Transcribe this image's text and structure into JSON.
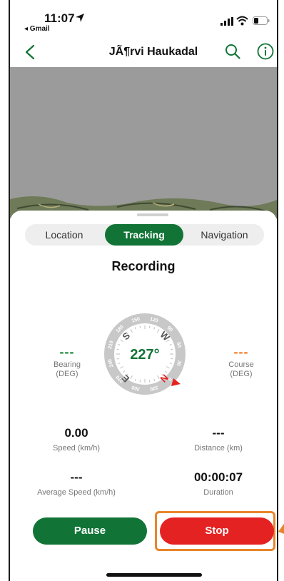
{
  "status_bar": {
    "time": "11:07",
    "back_app": "◂ Gmail"
  },
  "nav": {
    "title": "JÃ¶rvi Haukadal"
  },
  "tabs": [
    {
      "label": "Location",
      "selected": false
    },
    {
      "label": "Tracking",
      "selected": true
    },
    {
      "label": "Navigation",
      "selected": false
    }
  ],
  "tracking": {
    "status": "Recording",
    "compass": {
      "heading": "227°",
      "ring_labels": [
        "0",
        "30",
        "60",
        "90",
        "120",
        "150",
        "180",
        "210",
        "240",
        "270",
        "300",
        "330"
      ],
      "cardinals": {
        "north": "N",
        "east": "E",
        "south": "S",
        "west": "W"
      }
    },
    "bearing": {
      "value": "---",
      "label_line1": "Bearing",
      "label_line2": "(DEG)"
    },
    "course": {
      "value": "---",
      "label_line1": "Course",
      "label_line2": "(DEG)"
    },
    "stats": {
      "speed": {
        "value": "0.00",
        "label": "Speed (km/h)"
      },
      "distance": {
        "value": "---",
        "label": "Distance (km)"
      },
      "average_speed": {
        "value": "---",
        "label": "Average Speed (km/h)"
      },
      "duration": {
        "value": "00:00:07",
        "label": "Duration"
      }
    }
  },
  "actions": {
    "pause_label": "Pause",
    "stop_label": "Stop"
  },
  "colors": {
    "primary_green": "#117436",
    "stop_red": "#e52222",
    "accent_orange": "#f07c28",
    "bearing_green": "#1e8a3f"
  },
  "icons": {
    "location": "location-arrow-icon",
    "signal": "cellular-signal-icon",
    "wifi": "wifi-icon",
    "battery": "battery-icon",
    "back": "chevron-left-icon",
    "search": "search-icon",
    "info": "info-icon",
    "north_marker": "north-marker-icon"
  }
}
